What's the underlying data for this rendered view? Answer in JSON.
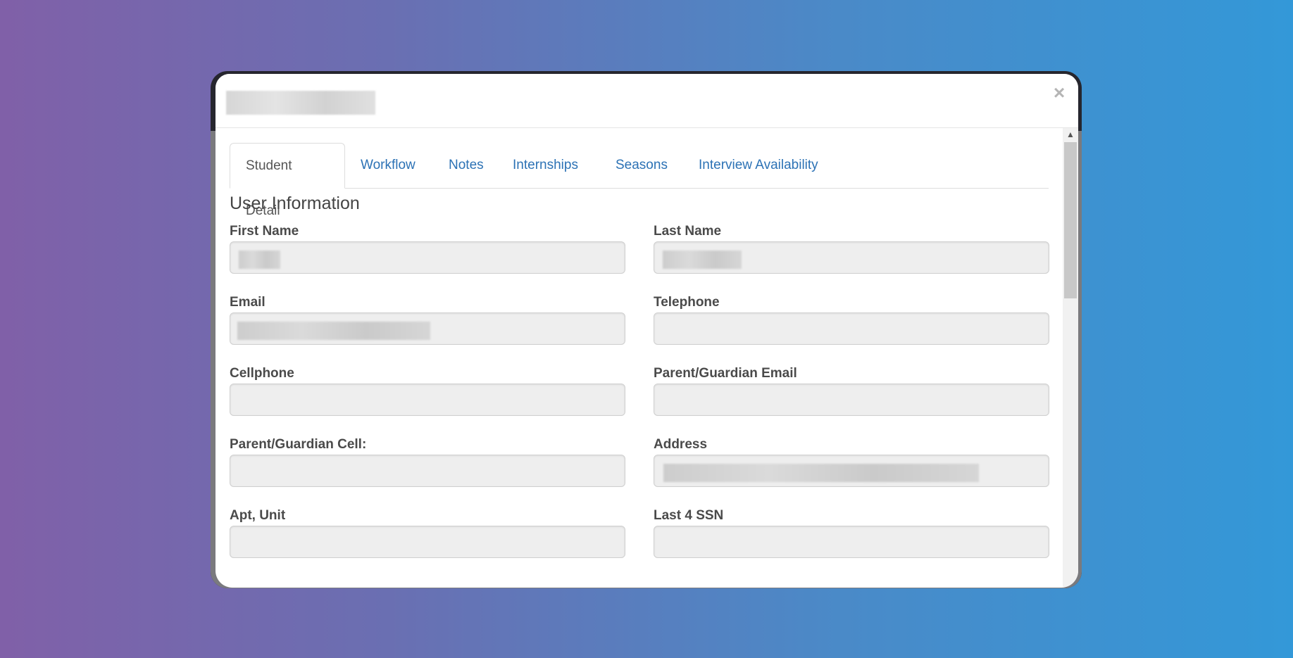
{
  "modal": {
    "close_label": "×"
  },
  "tabs": [
    {
      "label": "Student Detail",
      "active": true
    },
    {
      "label": "Workflow",
      "active": false
    },
    {
      "label": "Notes",
      "active": false
    },
    {
      "label": "Internships",
      "active": false
    },
    {
      "label": "Seasons",
      "active": false
    },
    {
      "label": "Interview Availability",
      "active": false
    }
  ],
  "section": {
    "title": "User Information"
  },
  "fields": {
    "first_name": {
      "label": "First Name",
      "value": ""
    },
    "last_name": {
      "label": "Last Name",
      "value": ""
    },
    "email": {
      "label": "Email",
      "value": ""
    },
    "telephone": {
      "label": "Telephone",
      "value": ""
    },
    "cellphone": {
      "label": "Cellphone",
      "value": ""
    },
    "parent_email": {
      "label": "Parent/Guardian Email",
      "value": ""
    },
    "parent_cell": {
      "label": "Parent/Guardian Cell:",
      "value": ""
    },
    "address": {
      "label": "Address",
      "value": ""
    },
    "apt_unit": {
      "label": "Apt, Unit",
      "value": ""
    },
    "last4_ssn": {
      "label": "Last 4 SSN",
      "value": ""
    }
  },
  "colors": {
    "link": "#2c72b5",
    "input_bg": "#eeeeee",
    "label": "#4a4a4a"
  }
}
